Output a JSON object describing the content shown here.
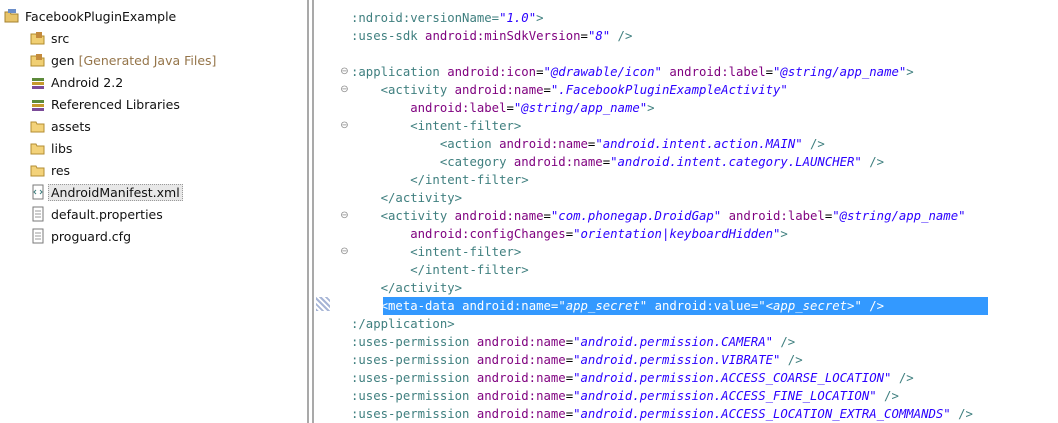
{
  "tree": {
    "items": [
      {
        "label": "FacebookPluginExample",
        "icon": "project-icon",
        "decoration": ""
      },
      {
        "label": "src",
        "icon": "source-folder-icon",
        "decoration": ""
      },
      {
        "label": "gen",
        "icon": "source-folder-icon",
        "decoration": "[Generated Java Files]"
      },
      {
        "label": "Android 2.2",
        "icon": "library-icon",
        "decoration": ""
      },
      {
        "label": "Referenced Libraries",
        "icon": "library-icon",
        "decoration": ""
      },
      {
        "label": "assets",
        "icon": "folder-icon",
        "decoration": ""
      },
      {
        "label": "libs",
        "icon": "folder-icon",
        "decoration": ""
      },
      {
        "label": "res",
        "icon": "folder-icon",
        "decoration": ""
      },
      {
        "label": "AndroidManifest.xml",
        "icon": "xml-file-icon",
        "decoration": ""
      },
      {
        "label": "default.properties",
        "icon": "text-file-icon",
        "decoration": ""
      },
      {
        "label": "proguard.cfg",
        "icon": "text-file-icon",
        "decoration": ""
      }
    ],
    "selected_index": 8
  },
  "colors": {
    "tag": "#3f7f7f",
    "attr": "#7f007f",
    "value": "#2a00ff",
    "selection": "#3399ff"
  },
  "editor": {
    "lines": [
      {
        "id": "l1",
        "parts": [
          [
            "t",
            ":ndroid:versionName="
          ],
          [
            "v",
            "\"1.0\""
          ],
          [
            "t",
            ">"
          ]
        ]
      },
      {
        "id": "l2",
        "parts": [
          [
            "t",
            ":uses-sdk "
          ],
          [
            "a",
            "android:minSdkVersion"
          ],
          [
            "p",
            "="
          ],
          [
            "v",
            "\"8\""
          ],
          [
            "t",
            " />"
          ]
        ]
      },
      {
        "id": "l3",
        "parts": []
      },
      {
        "id": "l4",
        "parts": [
          [
            "t",
            ":application "
          ],
          [
            "a",
            "android:icon"
          ],
          [
            "p",
            "="
          ],
          [
            "v",
            "\"@drawable/icon\""
          ],
          [
            "t",
            " "
          ],
          [
            "a",
            "android:label"
          ],
          [
            "p",
            "="
          ],
          [
            "v",
            "\"@string/app_name\""
          ],
          [
            "t",
            ">"
          ]
        ]
      },
      {
        "id": "l5",
        "parts": [
          [
            "t",
            "    <activity "
          ],
          [
            "a",
            "android:name"
          ],
          [
            "p",
            "="
          ],
          [
            "v",
            "\".FacebookPluginExampleActivity\""
          ]
        ]
      },
      {
        "id": "l6",
        "parts": [
          [
            "t",
            "        "
          ],
          [
            "a",
            "android:label"
          ],
          [
            "p",
            "="
          ],
          [
            "v",
            "\"@string/app_name\""
          ],
          [
            "t",
            ">"
          ]
        ]
      },
      {
        "id": "l7",
        "parts": [
          [
            "t",
            "        <intent-filter>"
          ]
        ]
      },
      {
        "id": "l8",
        "parts": [
          [
            "t",
            "            <action "
          ],
          [
            "a",
            "android:name"
          ],
          [
            "p",
            "="
          ],
          [
            "v",
            "\"android.intent.action.MAIN\""
          ],
          [
            "t",
            " />"
          ]
        ]
      },
      {
        "id": "l9",
        "parts": [
          [
            "t",
            "            <category "
          ],
          [
            "a",
            "android:name"
          ],
          [
            "p",
            "="
          ],
          [
            "v",
            "\"android.intent.category.LAUNCHER\""
          ],
          [
            "t",
            " />"
          ]
        ]
      },
      {
        "id": "l10",
        "parts": [
          [
            "t",
            "        </intent-filter>"
          ]
        ]
      },
      {
        "id": "l11",
        "parts": [
          [
            "t",
            "    </activity>"
          ]
        ]
      },
      {
        "id": "l12",
        "parts": [
          [
            "t",
            "    <activity "
          ],
          [
            "a",
            "android:name"
          ],
          [
            "p",
            "="
          ],
          [
            "v",
            "\"com.phonegap.DroidGap\""
          ],
          [
            "t",
            " "
          ],
          [
            "a",
            "android:label"
          ],
          [
            "p",
            "="
          ],
          [
            "v",
            "\"@string/app_name\""
          ]
        ]
      },
      {
        "id": "l13",
        "parts": [
          [
            "t",
            "        "
          ],
          [
            "a",
            "android:configChanges"
          ],
          [
            "p",
            "="
          ],
          [
            "v",
            "\"orientation|keyboardHidden\""
          ],
          [
            "t",
            ">"
          ]
        ]
      },
      {
        "id": "l14",
        "parts": [
          [
            "t",
            "        <intent-filter>"
          ]
        ]
      },
      {
        "id": "l15",
        "parts": [
          [
            "t",
            "        </intent-filter>"
          ]
        ]
      },
      {
        "id": "l16",
        "parts": [
          [
            "t",
            "    </activity>"
          ]
        ]
      },
      {
        "id": "l17",
        "selected": true,
        "parts": [
          [
            "t",
            "    <meta-data "
          ],
          [
            "a",
            "android:name"
          ],
          [
            "p",
            "="
          ],
          [
            "v",
            "\"app_secret\""
          ],
          [
            "t",
            " "
          ],
          [
            "a",
            "android:value"
          ],
          [
            "p",
            "="
          ],
          [
            "v",
            "\"<app_secret>\""
          ],
          [
            "t",
            " />"
          ]
        ]
      },
      {
        "id": "l18",
        "parts": [
          [
            "t",
            ":/application>"
          ]
        ]
      },
      {
        "id": "l19",
        "parts": [
          [
            "t",
            ":uses-permission "
          ],
          [
            "a",
            "android:name"
          ],
          [
            "p",
            "="
          ],
          [
            "v",
            "\"android.permission.CAMERA\""
          ],
          [
            "t",
            " />"
          ]
        ]
      },
      {
        "id": "l20",
        "parts": [
          [
            "t",
            ":uses-permission "
          ],
          [
            "a",
            "android:name"
          ],
          [
            "p",
            "="
          ],
          [
            "v",
            "\"android.permission.VIBRATE\""
          ],
          [
            "t",
            " />"
          ]
        ]
      },
      {
        "id": "l21",
        "parts": [
          [
            "t",
            ":uses-permission "
          ],
          [
            "a",
            "android:name"
          ],
          [
            "p",
            "="
          ],
          [
            "v",
            "\"android.permission.ACCESS_COARSE_LOCATION\""
          ],
          [
            "t",
            " />"
          ]
        ]
      },
      {
        "id": "l22",
        "parts": [
          [
            "t",
            ":uses-permission "
          ],
          [
            "a",
            "android:name"
          ],
          [
            "p",
            "="
          ],
          [
            "v",
            "\"android.permission.ACCESS_FINE_LOCATION\""
          ],
          [
            "t",
            " />"
          ]
        ]
      },
      {
        "id": "l23",
        "parts": [
          [
            "t",
            ":uses-permission "
          ],
          [
            "a",
            "android:name"
          ],
          [
            "p",
            "="
          ],
          [
            "v",
            "\"android.permission.ACCESS_LOCATION_EXTRA_COMMANDS\""
          ],
          [
            "t",
            " />"
          ]
        ]
      }
    ],
    "fold_markers": [
      {
        "line": "l4",
        "symbol": "⊖"
      },
      {
        "line": "l5",
        "symbol": "⊖"
      },
      {
        "line": "l7",
        "symbol": "⊖"
      },
      {
        "line": "l12",
        "symbol": "⊖"
      },
      {
        "line": "l14",
        "symbol": "⊖"
      }
    ]
  }
}
